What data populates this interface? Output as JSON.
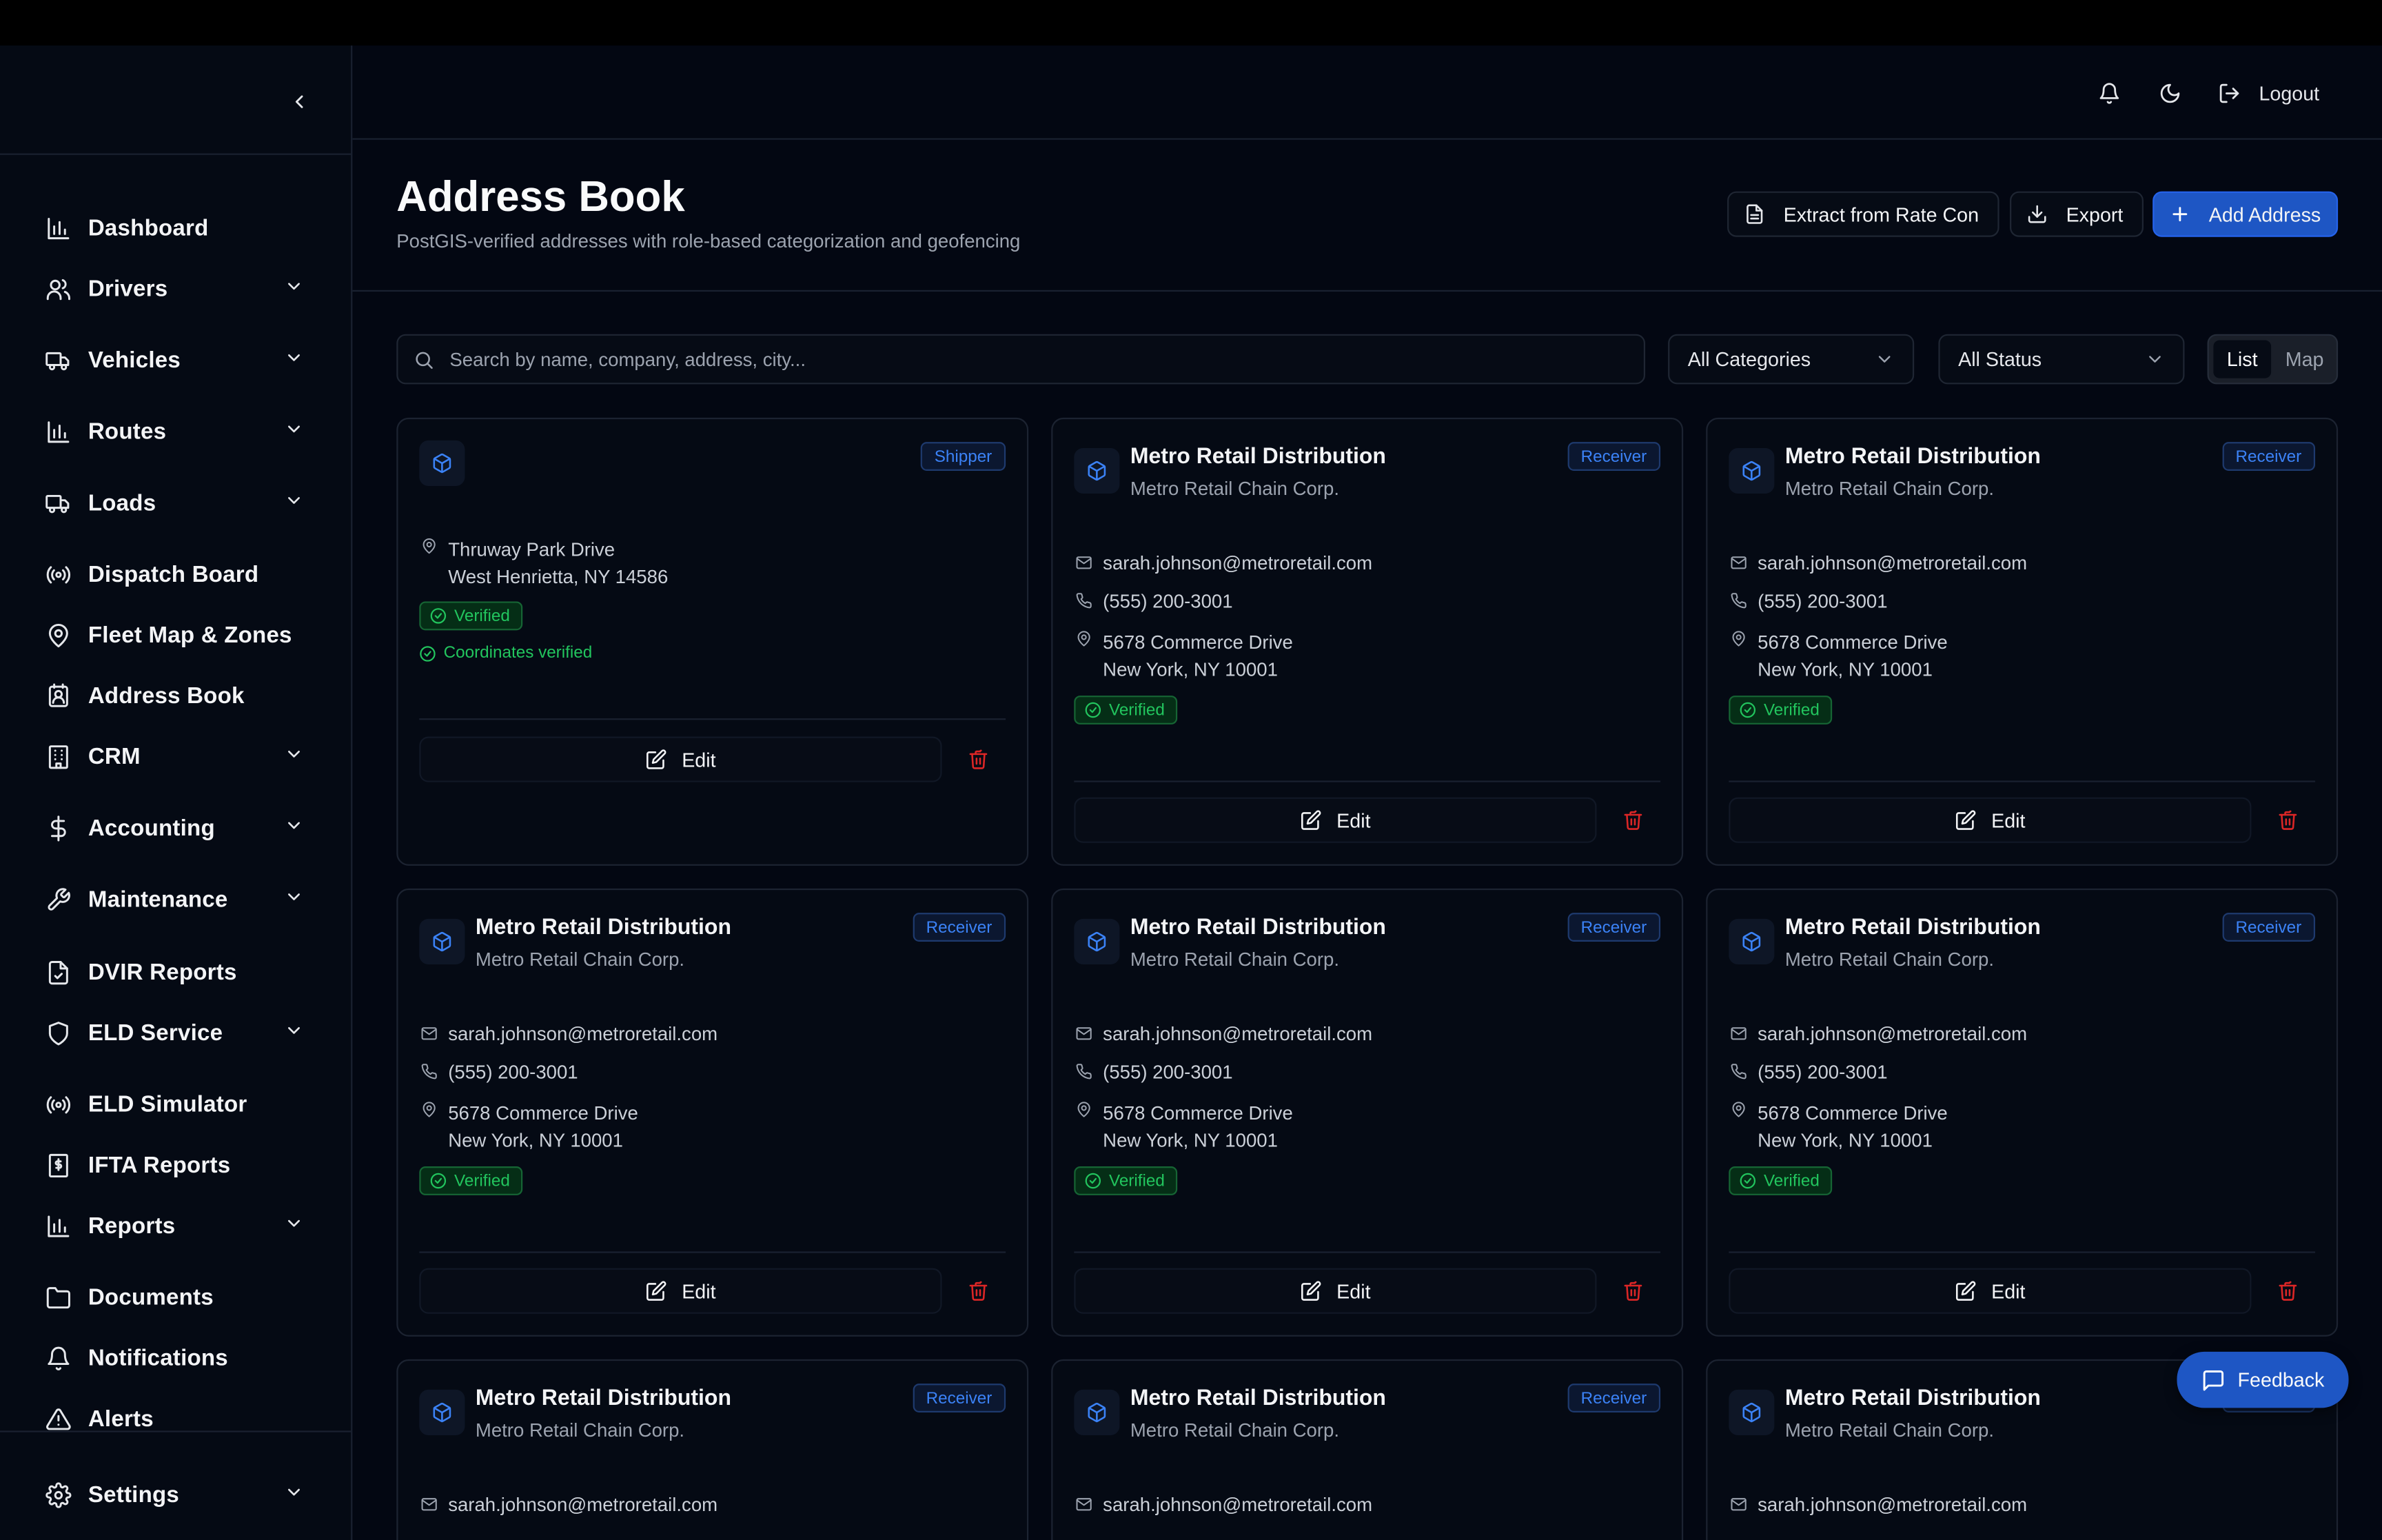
{
  "header": {
    "logout_label": "Logout"
  },
  "sidebar": {
    "items": [
      {
        "label": "Dashboard",
        "icon": "bar-chart-icon",
        "expandable": false
      },
      {
        "label": "Drivers",
        "icon": "users-icon",
        "expandable": true
      },
      {
        "label": "Vehicles",
        "icon": "truck-icon",
        "expandable": true
      },
      {
        "label": "Routes",
        "icon": "bar-chart-icon",
        "expandable": true
      },
      {
        "label": "Loads",
        "icon": "truck-icon",
        "expandable": true
      },
      {
        "label": "Dispatch Board",
        "icon": "radio-icon",
        "expandable": false
      },
      {
        "label": "Fleet Map & Zones",
        "icon": "map-pin-icon",
        "expandable": false
      },
      {
        "label": "Address Book",
        "icon": "contact-icon",
        "expandable": false
      },
      {
        "label": "CRM",
        "icon": "building-icon",
        "expandable": true
      },
      {
        "label": "Accounting",
        "icon": "dollar-icon",
        "expandable": true
      },
      {
        "label": "Maintenance",
        "icon": "wrench-icon",
        "expandable": true
      },
      {
        "label": "DVIR Reports",
        "icon": "file-check-icon",
        "expandable": false
      },
      {
        "label": "ELD Service",
        "icon": "shield-icon",
        "expandable": true
      },
      {
        "label": "ELD Simulator",
        "icon": "radio-icon",
        "expandable": false
      },
      {
        "label": "IFTA Reports",
        "icon": "receipt-icon",
        "expandable": false
      },
      {
        "label": "Reports",
        "icon": "bar-chart-icon",
        "expandable": true
      },
      {
        "label": "Documents",
        "icon": "folder-icon",
        "expandable": false
      },
      {
        "label": "Notifications",
        "icon": "bell-icon",
        "expandable": false
      },
      {
        "label": "Alerts",
        "icon": "alert-triangle-icon",
        "expandable": false
      },
      {
        "label": "Settings",
        "icon": "gear-icon",
        "expandable": true
      }
    ]
  },
  "page": {
    "title": "Address Book",
    "subtitle": "PostGIS-verified addresses with role-based categorization and geofencing",
    "extract_label": "Extract from Rate Con",
    "export_label": "Export",
    "add_label": "Add Address"
  },
  "filters": {
    "search_placeholder": "Search by name, company, address, city...",
    "category": "All Categories",
    "status": "All Status",
    "view_list": "List",
    "view_map": "Map"
  },
  "cards": [
    {
      "name": "",
      "company": "",
      "badge": "Shipper",
      "email": "",
      "phone": "",
      "address1": "Thruway Park Drive",
      "address2": "West Henrietta, NY 14586",
      "verified": "Verified",
      "coords": "Coordinates verified"
    },
    {
      "name": "Metro Retail Distribution",
      "company": "Metro Retail Chain Corp.",
      "badge": "Receiver",
      "email": "sarah.johnson@metroretail.com",
      "phone": "(555) 200-3001",
      "address1": "5678 Commerce Drive",
      "address2": "New York, NY 10001",
      "verified": "Verified"
    },
    {
      "name": "Metro Retail Distribution",
      "company": "Metro Retail Chain Corp.",
      "badge": "Receiver",
      "email": "sarah.johnson@metroretail.com",
      "phone": "(555) 200-3001",
      "address1": "5678 Commerce Drive",
      "address2": "New York, NY 10001",
      "verified": "Verified"
    },
    {
      "name": "Metro Retail Distribution",
      "company": "Metro Retail Chain Corp.",
      "badge": "Receiver",
      "email": "sarah.johnson@metroretail.com",
      "phone": "(555) 200-3001",
      "address1": "5678 Commerce Drive",
      "address2": "New York, NY 10001",
      "verified": "Verified"
    },
    {
      "name": "Metro Retail Distribution",
      "company": "Metro Retail Chain Corp.",
      "badge": "Receiver",
      "email": "sarah.johnson@metroretail.com",
      "phone": "(555) 200-3001",
      "address1": "5678 Commerce Drive",
      "address2": "New York, NY 10001",
      "verified": "Verified"
    },
    {
      "name": "Metro Retail Distribution",
      "company": "Metro Retail Chain Corp.",
      "badge": "Receiver",
      "email": "sarah.johnson@metroretail.com",
      "phone": "(555) 200-3001",
      "address1": "5678 Commerce Drive",
      "address2": "New York, NY 10001",
      "verified": "Verified"
    },
    {
      "name": "Metro Retail Distribution",
      "company": "Metro Retail Chain Corp.",
      "badge": "Receiver",
      "email": "sarah.johnson@metroretail.com"
    },
    {
      "name": "Metro Retail Distribution",
      "company": "Metro Retail Chain Corp.",
      "badge": "Receiver",
      "email": "sarah.johnson@metroretail.com"
    },
    {
      "name": "Metro Retail Distribution",
      "company": "Metro Retail Chain Corp.",
      "badge": "Receiver",
      "email": "sarah.johnson@metroretail.com"
    }
  ],
  "edit_label": "Edit",
  "feedback_label": "Feedback",
  "colors": {
    "background": "#030712",
    "accent": "#1e56c4",
    "verified": "#22c55e",
    "delete": "#dc2626",
    "badge_blue": "#3b82f6"
  }
}
